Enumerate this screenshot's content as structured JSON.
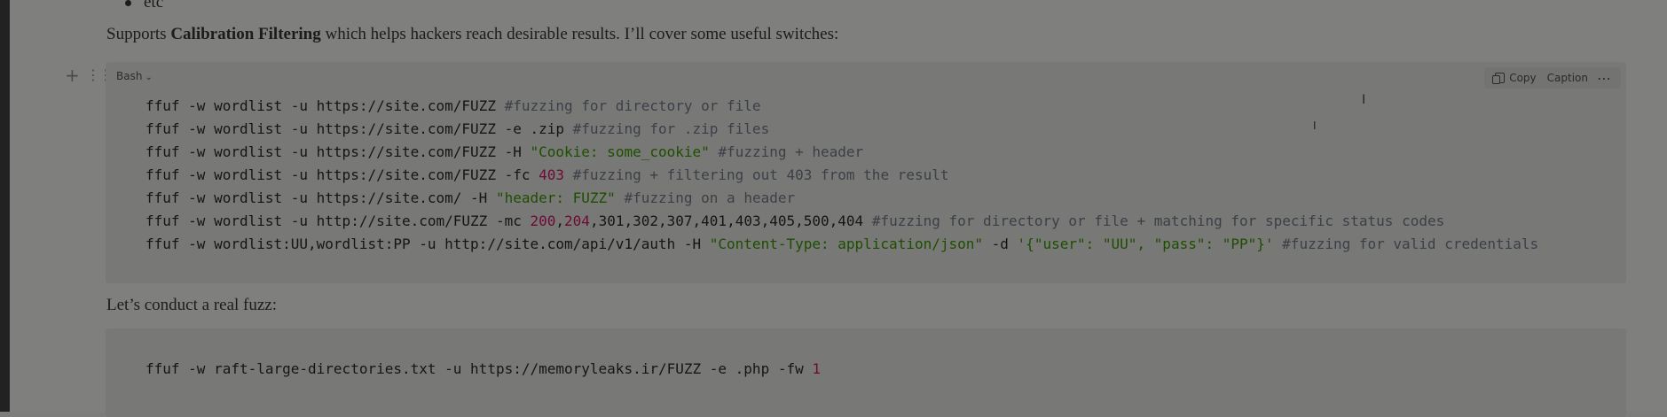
{
  "bullet": {
    "text": "etc"
  },
  "para1": {
    "before": "Supports ",
    "bold": "Calibration Filtering",
    "after": " which helps hackers reach desirable results. I’ll cover some useful switches:"
  },
  "code_block_1": {
    "language": "Bash",
    "toolbar": {
      "copy_label": "Copy",
      "caption_label": "Caption",
      "more_label": "⋯"
    },
    "lines": [
      [
        {
          "t": "ffuf -w wordlist -u https://site.com/FUZZ ",
          "c": "plain"
        },
        {
          "t": "#fuzzing for directory or file",
          "c": "com"
        }
      ],
      [
        {
          "t": "ffuf -w wordlist -u https://site.com/FUZZ -e .zip ",
          "c": "plain"
        },
        {
          "t": "#fuzzing for .zip files",
          "c": "com"
        }
      ],
      [
        {
          "t": "ffuf -w wordlist -u https://site.com/FUZZ -H ",
          "c": "plain"
        },
        {
          "t": "\"Cookie: some_cookie\"",
          "c": "str"
        },
        {
          "t": " ",
          "c": "plain"
        },
        {
          "t": "#fuzzing + header",
          "c": "com"
        }
      ],
      [
        {
          "t": "ffuf -w wordlist -u https://site.com/FUZZ -fc ",
          "c": "plain"
        },
        {
          "t": "403",
          "c": "num"
        },
        {
          "t": " ",
          "c": "plain"
        },
        {
          "t": "#fuzzing + filtering out 403 from the result",
          "c": "com"
        }
      ],
      [
        {
          "t": "ffuf -w wordlist -u https://site.com/ -H ",
          "c": "plain"
        },
        {
          "t": "\"header: FUZZ\"",
          "c": "str"
        },
        {
          "t": " ",
          "c": "plain"
        },
        {
          "t": "#fuzzing on a header",
          "c": "com"
        }
      ],
      [
        {
          "t": "ffuf -w wordlist -u http://site.com/FUZZ -mc ",
          "c": "plain"
        },
        {
          "t": "200",
          "c": "num"
        },
        {
          "t": ",",
          "c": "plain"
        },
        {
          "t": "204",
          "c": "num"
        },
        {
          "t": ",301,302,307,401,403,405,500,404 ",
          "c": "plain"
        },
        {
          "t": "#fuzzing for directory or file + matching for specific status codes",
          "c": "com"
        }
      ],
      [
        {
          "t": "ffuf -w wordlist:UU,wordlist:PP -u http://site.com/api/v1/auth -H ",
          "c": "plain"
        },
        {
          "t": "\"Content-Type: application/json\"",
          "c": "str"
        },
        {
          "t": " -d ",
          "c": "plain"
        },
        {
          "t": "'{\"user\": \"UU\", \"pass\": \"PP\"}'",
          "c": "str"
        },
        {
          "t": " ",
          "c": "plain"
        },
        {
          "t": "#fuzzing for valid credentials",
          "c": "com"
        }
      ]
    ]
  },
  "para2": {
    "text": "Let’s conduct a real fuzz:"
  },
  "code_block_2": {
    "lines": [
      [
        {
          "t": "ffuf -w raft-large-directories.txt -u https://memoryleaks.ir/FUZZ -e .php -fw ",
          "c": "plain"
        },
        {
          "t": "1",
          "c": "num"
        }
      ]
    ]
  },
  "icons": {
    "plus": "plus-icon",
    "drag": "drag-handle-icon",
    "copy": "copy-icon",
    "more": "more-icon",
    "cursor": "text-cursor-icon"
  }
}
